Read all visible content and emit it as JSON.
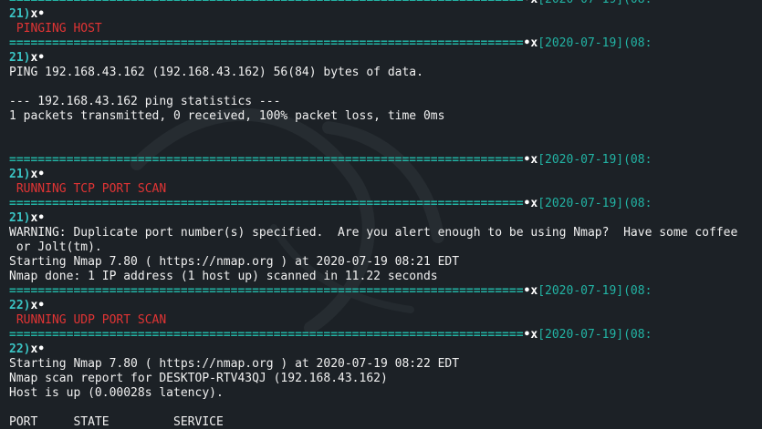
{
  "colors": {
    "background": "#1c2126",
    "separator": "#22b3a4",
    "heading": "#e03434",
    "text": "#f0f0f0"
  },
  "separator_rule": "========================================================================",
  "separator_mark": "•x",
  "lines": [
    {
      "kind": "sep",
      "text": "",
      "ts": "[2020-07-19](08:"
    },
    {
      "kind": "num",
      "text": "21)",
      "mark": "x•"
    },
    {
      "kind": "head",
      "text": " PINGING HOST"
    },
    {
      "kind": "sep",
      "text": "",
      "ts": "[2020-07-19](08:"
    },
    {
      "kind": "num",
      "text": "21)",
      "mark": "x•"
    },
    {
      "kind": "out",
      "text": "PING 192.168.43.162 (192.168.43.162) 56(84) bytes of data."
    },
    {
      "kind": "blank",
      "text": ""
    },
    {
      "kind": "out",
      "text": "--- 192.168.43.162 ping statistics ---"
    },
    {
      "kind": "out",
      "text": "1 packets transmitted, 0 received, 100% packet loss, time 0ms"
    },
    {
      "kind": "blank",
      "text": ""
    },
    {
      "kind": "blank",
      "text": ""
    },
    {
      "kind": "sep",
      "text": "",
      "ts": "[2020-07-19](08:"
    },
    {
      "kind": "num",
      "text": "21)",
      "mark": "x•"
    },
    {
      "kind": "head",
      "text": " RUNNING TCP PORT SCAN"
    },
    {
      "kind": "sep",
      "text": "",
      "ts": "[2020-07-19](08:"
    },
    {
      "kind": "num",
      "text": "21)",
      "mark": "x•"
    },
    {
      "kind": "out",
      "text": "WARNING: Duplicate port number(s) specified.  Are you alert enough to be using Nmap?  Have some coffee"
    },
    {
      "kind": "out",
      "text": " or Jolt(tm)."
    },
    {
      "kind": "out",
      "text": "Starting Nmap 7.80 ( https://nmap.org ) at 2020-07-19 08:21 EDT"
    },
    {
      "kind": "out",
      "text": "Nmap done: 1 IP address (1 host up) scanned in 11.22 seconds"
    },
    {
      "kind": "sep",
      "text": "",
      "ts": "[2020-07-19](08:"
    },
    {
      "kind": "num",
      "text": "22)",
      "mark": "x•"
    },
    {
      "kind": "head",
      "text": " RUNNING UDP PORT SCAN"
    },
    {
      "kind": "sep",
      "text": "",
      "ts": "[2020-07-19](08:"
    },
    {
      "kind": "num",
      "text": "22)",
      "mark": "x•"
    },
    {
      "kind": "out",
      "text": "Starting Nmap 7.80 ( https://nmap.org ) at 2020-07-19 08:22 EDT"
    },
    {
      "kind": "out",
      "text": "Nmap scan report for DESKTOP-RTV43QJ (192.168.43.162)"
    },
    {
      "kind": "out",
      "text": "Host is up (0.00028s latency)."
    },
    {
      "kind": "blank",
      "text": ""
    },
    {
      "kind": "out",
      "text": "PORT     STATE         SERVICE"
    }
  ]
}
